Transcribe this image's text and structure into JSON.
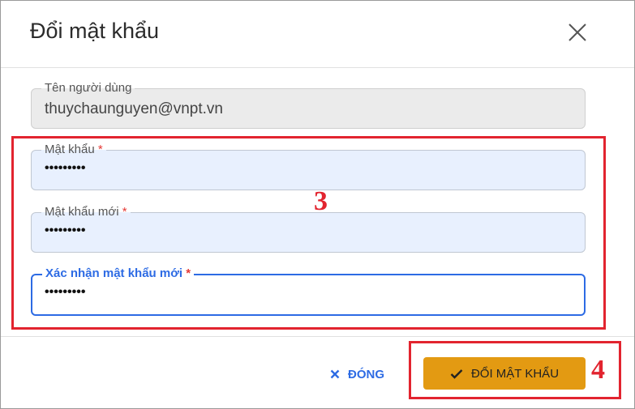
{
  "dialog": {
    "title": "Đổi mật khẩu",
    "close_icon": "close-icon"
  },
  "fields": {
    "username": {
      "label": "Tên người dùng",
      "value": "thuychaunguyen@vnpt.vn"
    },
    "password": {
      "label": "Mật khẩu",
      "required_mark": "*",
      "value": "•••••••••"
    },
    "new_password": {
      "label": "Mật khẩu mới",
      "required_mark": "*",
      "value": "•••••••••"
    },
    "confirm_password": {
      "label": "Xác nhận mật khẩu mới",
      "required_mark": "*",
      "value": "•••••••••"
    }
  },
  "footer": {
    "cancel_label": "ĐÓNG",
    "cancel_icon": "x-icon",
    "confirm_label": "ĐỔI MẬT KHẨU",
    "confirm_icon": "check-icon"
  },
  "annotations": {
    "fields_step": "3",
    "button_step": "4"
  },
  "colors": {
    "accent_blue": "#2d6be4",
    "confirm_orange": "#e39a12",
    "annotation_red": "#e2242f",
    "required_red": "#e53935"
  }
}
